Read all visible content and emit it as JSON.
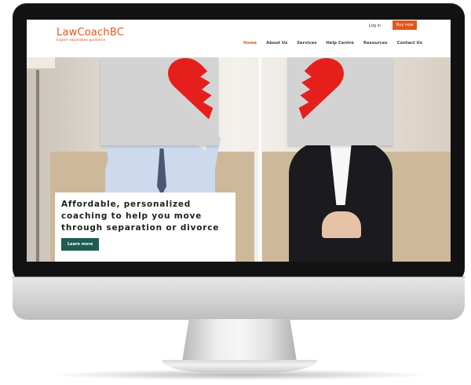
{
  "site": {
    "logo_title": "LawCoachBC",
    "logo_subtitle": "Expert separation guidance",
    "login_label": "Log in",
    "buy_now_label": "Buy now",
    "nav": [
      {
        "label": "Home",
        "active": true
      },
      {
        "label": "About Us",
        "active": false
      },
      {
        "label": "Services",
        "active": false
      },
      {
        "label": "Help Centre",
        "active": false
      },
      {
        "label": "Resources",
        "active": false
      },
      {
        "label": "Contact Us",
        "active": false
      }
    ]
  },
  "hero": {
    "headline": "Affordable, personalized coaching to help you move through separation or divorce",
    "cta_label": "Learn more"
  },
  "colors": {
    "brand_orange": "#e2561e",
    "cta_teal": "#1e5c55",
    "heart_red": "#e5201c",
    "monitor_bezel": "#121212"
  },
  "icons": [
    "broken-heart-left-icon",
    "broken-heart-right-icon"
  ]
}
